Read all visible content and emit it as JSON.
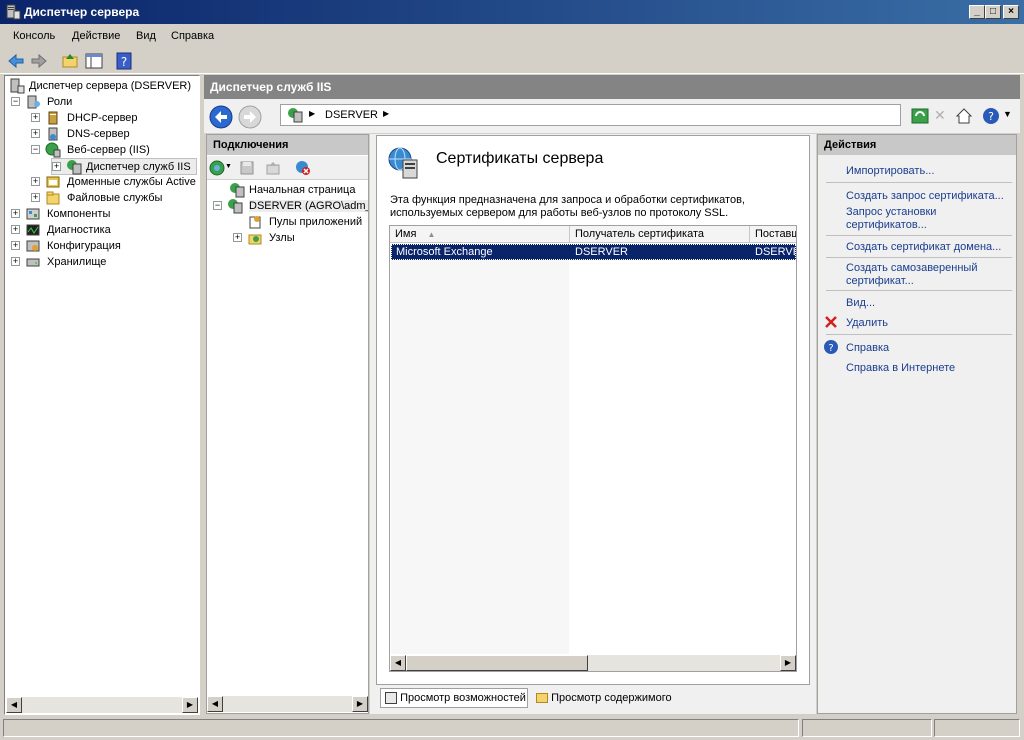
{
  "window": {
    "title": "Диспетчер сервера"
  },
  "menu": [
    "Консоль",
    "Действие",
    "Вид",
    "Справка"
  ],
  "tree": {
    "items": [
      {
        "label": "Диспетчер сервера (DSERVER)",
        "expander": ""
      },
      {
        "label": "Роли",
        "expander": "−"
      },
      {
        "label": "DHCP-сервер",
        "expander": "+"
      },
      {
        "label": "DNS-сервер",
        "expander": "+"
      },
      {
        "label": "Веб-сервер (IIS)",
        "expander": "−"
      },
      {
        "label": "Диспетчер служб IIS",
        "expander": "+"
      },
      {
        "label": "Доменные службы Active",
        "expander": "+"
      },
      {
        "label": "Файловые службы",
        "expander": "+"
      },
      {
        "label": "Компоненты",
        "expander": "+"
      },
      {
        "label": "Диагностика",
        "expander": "+"
      },
      {
        "label": "Конфигурация",
        "expander": "+"
      },
      {
        "label": "Хранилище",
        "expander": "+"
      }
    ]
  },
  "iis": {
    "header": "Диспетчер служб IIS",
    "address": "DSERVER",
    "connections": {
      "title": "Подключения",
      "items": [
        {
          "label": "Начальная страница",
          "expander": ""
        },
        {
          "label": "DSERVER (AGRO\\adm_sc",
          "expander": "−"
        },
        {
          "label": "Пулы приложений",
          "expander": ""
        },
        {
          "label": "Узлы",
          "expander": "+"
        }
      ]
    },
    "feature": {
      "title": "Сертификаты сервера",
      "description_line1": "Эта функция предназначена для запроса и обработки сертификатов,",
      "description_line2": "используемых сервером для работы веб-узлов по протоколу SSL.",
      "columns": [
        "Имя",
        "Получатель сертификата",
        "Поставщ"
      ],
      "rows": [
        {
          "name": "Microsoft Exchange",
          "subject": "DSERVER",
          "issuer": "DSERVER"
        }
      ]
    },
    "views": {
      "features": "Просмотр возможностей",
      "content": "Просмотр содержимого"
    },
    "actions": {
      "title": "Действия",
      "import": "Импортировать...",
      "create_request": "Создать запрос сертификата...",
      "complete_request_1": "Запрос установки",
      "complete_request_2": "сертификатов...",
      "create_domain": "Создать сертификат домена...",
      "self_signed_1": "Создать самозаверенный",
      "self_signed_2": "сертификат...",
      "view": "Вид...",
      "delete": "Удалить",
      "help": "Справка",
      "online_help": "Справка в Интернете"
    }
  },
  "colors": {
    "accent": "#0a246a",
    "link": "#1a3d8f",
    "header_gray": "#848484"
  }
}
